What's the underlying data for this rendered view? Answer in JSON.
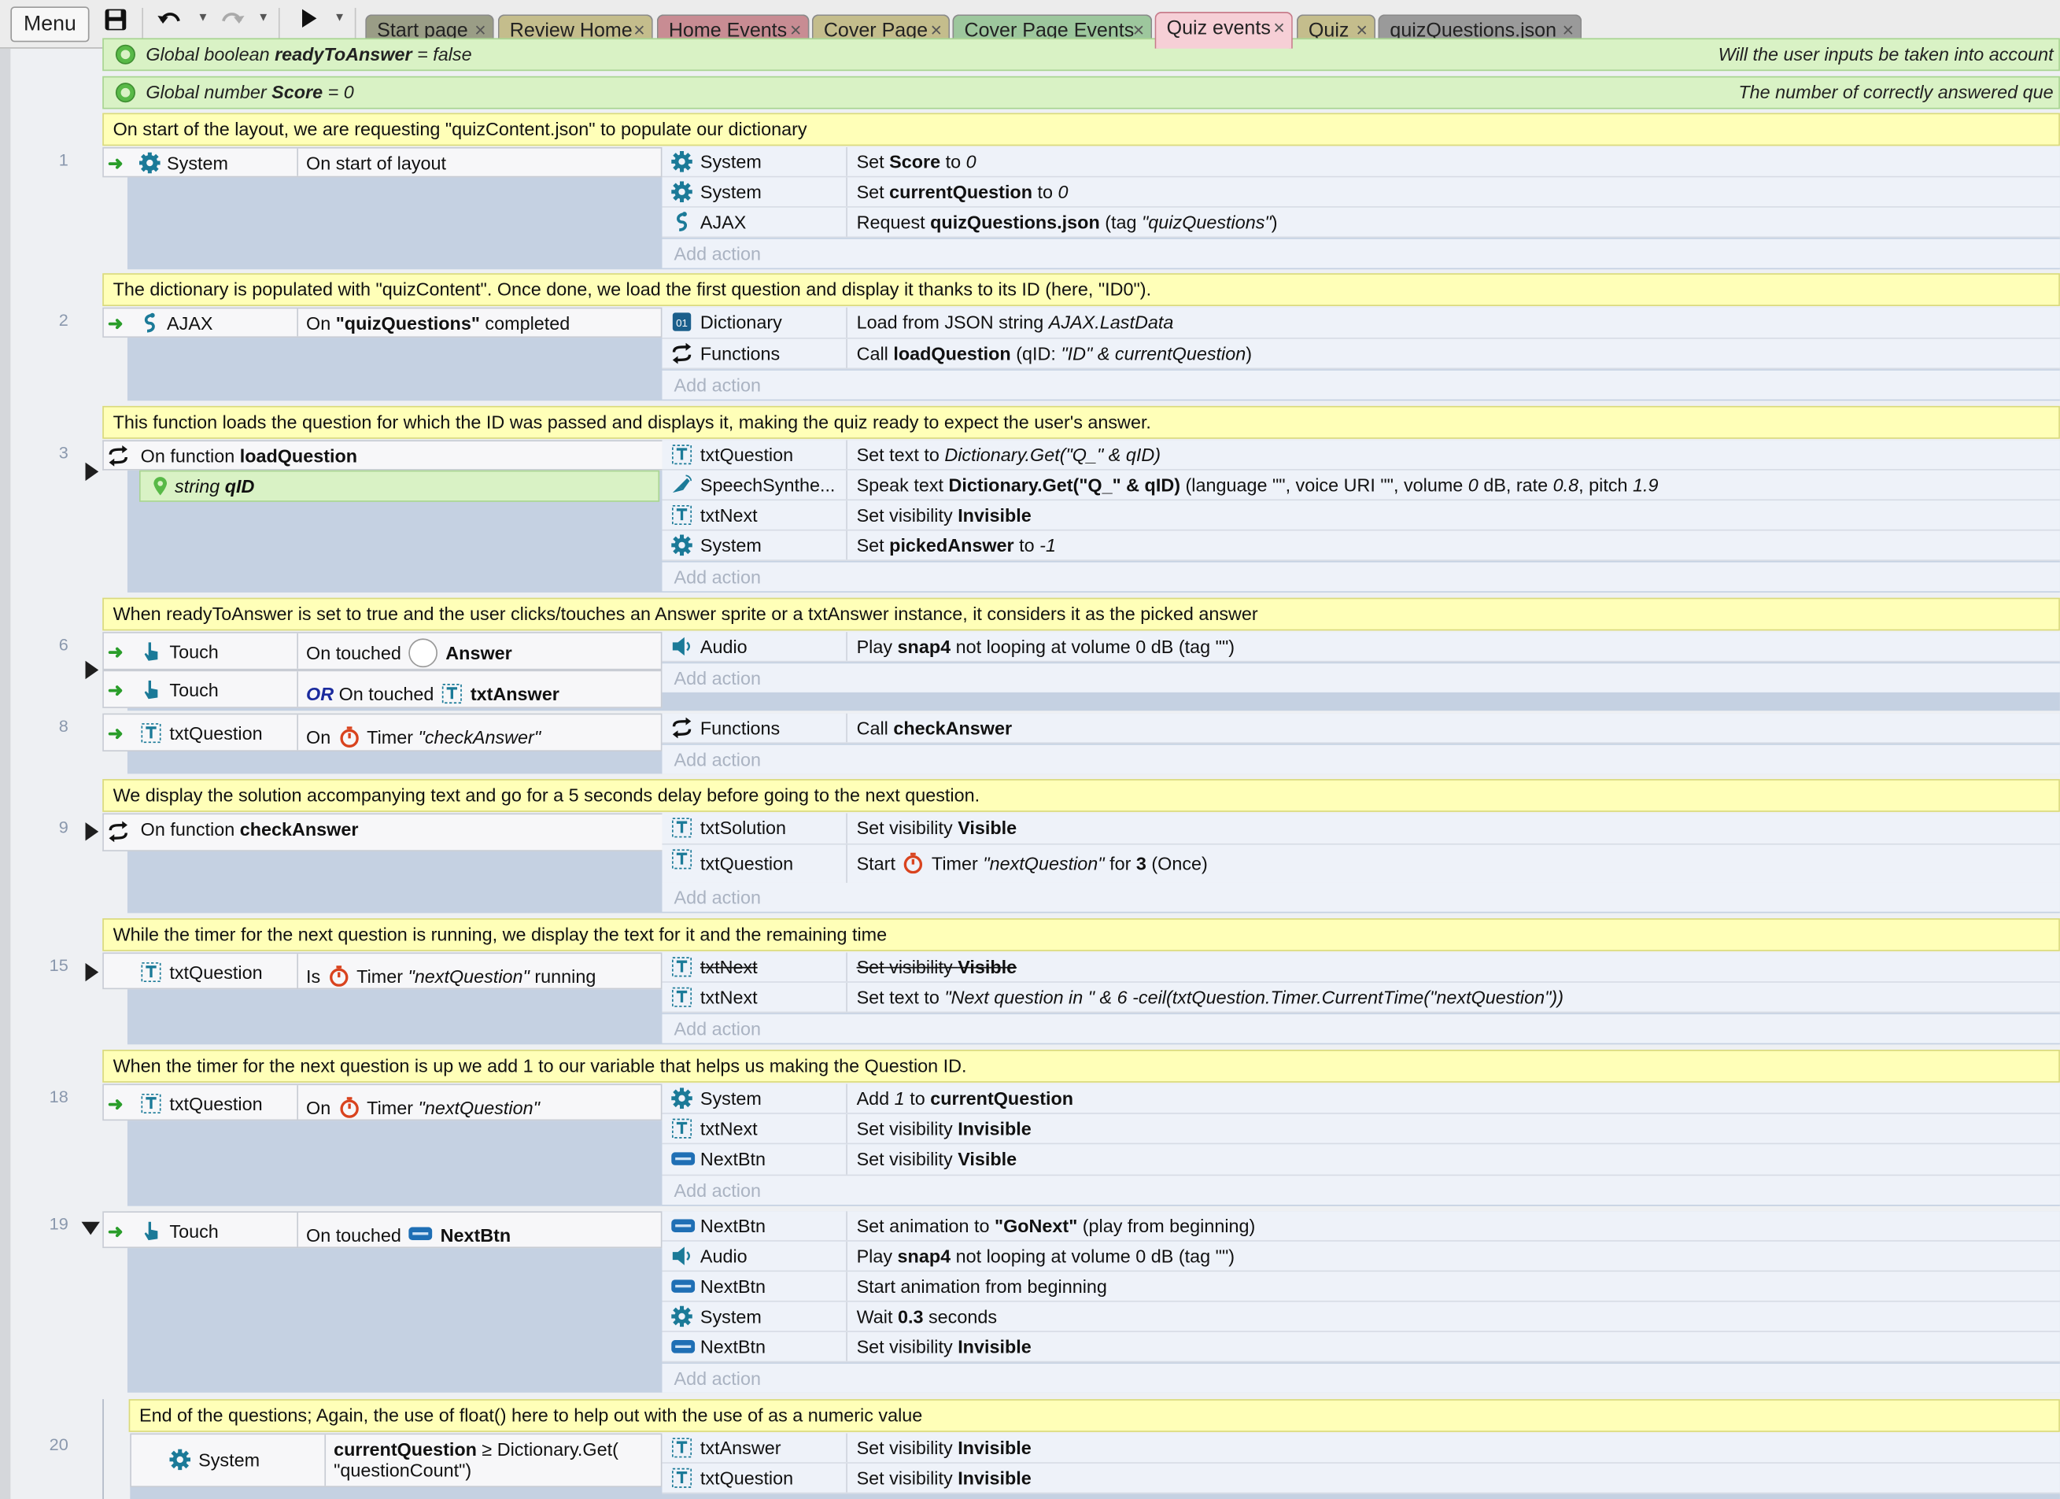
{
  "toolbar": {
    "menu_label": "Menu",
    "icons": [
      "save-icon",
      "undo-icon",
      "redo-icon",
      "play-icon"
    ]
  },
  "tabs": [
    {
      "label": "Start page",
      "color": "#9a9d86",
      "active": false
    },
    {
      "label": "Review Home",
      "color": "#c4bd8c",
      "active": false
    },
    {
      "label": "Home Events",
      "color": "#c88c93",
      "active": false
    },
    {
      "label": "Cover Page",
      "color": "#c4bd8c",
      "active": false
    },
    {
      "label": "Cover Page Events",
      "color": "#9dc79d",
      "active": false
    },
    {
      "label": "Quiz events",
      "color": "#f6cfd6",
      "active": true
    },
    {
      "label": "Quiz",
      "color": "#c4bd8c",
      "active": false
    },
    {
      "label": "quizQuestions.json",
      "color": "#9a9a9a",
      "active": false
    }
  ],
  "globals": {
    "g1": {
      "pre": "Global boolean ",
      "name": "readyToAnswer",
      "post": " = false",
      "comment": "Will the user inputs be taken into account"
    },
    "g2": {
      "pre": "Global number ",
      "name": "Score",
      "post": " = 0",
      "comment": "The number of correctly answered que"
    }
  },
  "comments": {
    "c1": "On start of the layout, we are requesting \"quizContent.json\" to populate our dictionary",
    "c2": "The dictionary is populated with \"quizContent\". Once done, we load the first question and display it thanks to its ID (here, \"ID0\").",
    "c3": "This function loads the question for which the ID was passed and displays it, making the quiz ready to expect the user's answer.",
    "c4": "When readyToAnswer is set to true and the user clicks/touches an Answer sprite or a txtAnswer instance, it considers it as the picked answer",
    "c5": "We display the solution accompanying text and go for a 5 seconds delay before going to the next question.",
    "c6": "While the timer for the next question is running, we display the text for it and the remaining time",
    "c7": "When the timer for the next question is up we add 1 to our variable that helps us making the Question ID.",
    "c8": "End of the questions; Again, the use of float() here to help out with the use of as a numeric value"
  },
  "events": {
    "e1": {
      "num": "1",
      "cond_obj": "System",
      "cond_desc": "On start of layout",
      "actions": [
        {
          "obj": "System",
          "pre": "Set ",
          "b": "Score",
          "post": " to ",
          "i": "0"
        },
        {
          "obj": "System",
          "pre": "Set ",
          "b": "currentQuestion",
          "post": " to ",
          "i": "0"
        },
        {
          "obj": "AJAX",
          "pre": "Request ",
          "b": "quizQuestions.json",
          "post": " (tag ",
          "i": "\"quizQuestions\"",
          "end": ")"
        }
      ]
    },
    "e2": {
      "num": "2",
      "cond_obj": "AJAX",
      "cond_pre": "On ",
      "cond_b": "\"quizQuestions\"",
      "cond_post": " completed",
      "actions": [
        {
          "obj": "Dictionary",
          "pre": "Load from JSON string ",
          "i": "AJAX.LastData"
        },
        {
          "obj": "Functions",
          "pre": "Call ",
          "b": "loadQuestion",
          "post": " (qID: ",
          "i": "\"ID\" & currentQuestion",
          "end": ")"
        }
      ]
    },
    "e3": {
      "num": "3",
      "cond_pre": "On function ",
      "cond_b": "loadQuestion",
      "param_type": "string ",
      "param_name": "qID",
      "actions": [
        {
          "obj": "txtQuestion",
          "pre": "Set text to ",
          "i": "Dictionary.Get(\"Q_\" & qID)"
        },
        {
          "obj": "SpeechSynthe...",
          "pre": "Speak text ",
          "b": "Dictionary.Get(\"Q_\" & qID)",
          "post": " (language \"\", voice URI \"\", volume ",
          "i": "0",
          "end": " dB, rate ",
          "i2": "0.8",
          "end2": ", pitch ",
          "i3": "1.9"
        },
        {
          "obj": "txtNext",
          "pre": "Set visibility ",
          "b": "Invisible"
        },
        {
          "obj": "System",
          "pre": "Set ",
          "b": "pickedAnswer",
          "post": " to ",
          "i": "-1"
        }
      ]
    },
    "e6": {
      "num": "6",
      "cond1_obj": "Touch",
      "cond1_pre": "On touched ",
      "cond1_b": "Answer",
      "cond2_obj": "Touch",
      "cond2_or": "OR",
      "cond2_pre": " On touched ",
      "cond2_b": "txtAnswer",
      "actions": [
        {
          "obj": "Audio",
          "pre": "Play ",
          "b": "snap4",
          "post": " not looping at volume 0 dB (tag \"\")"
        }
      ]
    },
    "e8": {
      "num": "8",
      "cond_obj": "txtQuestion",
      "cond_pre": "On ",
      "cond_mid": " Timer ",
      "cond_i": "\"checkAnswer\"",
      "actions": [
        {
          "obj": "Functions",
          "pre": "Call ",
          "b": "checkAnswer"
        }
      ]
    },
    "e9": {
      "num": "9",
      "cond_pre": "On function ",
      "cond_b": "checkAnswer",
      "actions": [
        {
          "obj": "txtSolution",
          "pre": "Set visibility ",
          "b": "Visible"
        },
        {
          "obj": "txtQuestion",
          "pre": "Start ",
          "mid": " Timer ",
          "i": "\"nextQuestion\"",
          "post": " for ",
          "b": "3",
          "end": " (Once)"
        }
      ]
    },
    "e15": {
      "num": "15",
      "cond_obj": "txtQuestion",
      "cond_pre": "Is ",
      "cond_mid": " Timer ",
      "cond_i": "\"nextQuestion\"",
      "cond_post": " running",
      "actions": [
        {
          "obj": "txtNext",
          "pre": "Set visibility ",
          "b": "Visible",
          "disabled": true
        },
        {
          "obj": "txtNext",
          "pre": "Set text to ",
          "i": "\"Next question in \" & 6 -ceil(txtQuestion.Timer.CurrentTime(\"nextQuestion\"))"
        }
      ]
    },
    "e18": {
      "num": "18",
      "cond_obj": "txtQuestion",
      "cond_pre": "On ",
      "cond_mid": " Timer ",
      "cond_i": "\"nextQuestion\"",
      "actions": [
        {
          "obj": "System",
          "pre": "Add ",
          "i": "1",
          "post": " to ",
          "b": "currentQuestion"
        },
        {
          "obj": "txtNext",
          "pre": "Set visibility ",
          "b": "Invisible"
        },
        {
          "obj": "NextBtn",
          "pre": "Set visibility ",
          "b": "Visible"
        }
      ]
    },
    "e19": {
      "num": "19",
      "cond_obj": "Touch",
      "cond_pre": "On touched ",
      "cond_b": "NextBtn",
      "actions": [
        {
          "obj": "NextBtn",
          "pre": "Set animation to ",
          "b": "\"GoNext\"",
          "post": " (play from beginning)"
        },
        {
          "obj": "Audio",
          "pre": "Play ",
          "b": "snap4",
          "post": " not looping at volume 0 dB (tag \"\")"
        },
        {
          "obj": "NextBtn",
          "pre": "Start animation from beginning"
        },
        {
          "obj": "System",
          "pre": "Wait ",
          "b": "0.3",
          "post": " seconds"
        },
        {
          "obj": "NextBtn",
          "pre": "Set visibility ",
          "b": "Invisible"
        }
      ]
    },
    "e20": {
      "num": "20",
      "cond_obj": "System",
      "cond_b": "currentQuestion",
      "cond_post": " ≥ Dictionary.Get(",
      "cond_line2": "\"questionCount\")",
      "actions": [
        {
          "obj": "txtAnswer",
          "pre": "Set visibility ",
          "b": "Invisible"
        },
        {
          "obj": "txtQuestion",
          "pre": "Set visibility ",
          "b": "Invisible"
        }
      ]
    }
  },
  "add_action_label": "Add action",
  "colors": {
    "comment_bg": "#ffffb8",
    "variable_bg": "#d9f2c5",
    "event_bg": "#c5d1e2",
    "action_bg": "#eef2f9",
    "icon_teal": "#1b7a98",
    "timer_red": "#d9431e",
    "or_blue": "#1b2b9e"
  }
}
